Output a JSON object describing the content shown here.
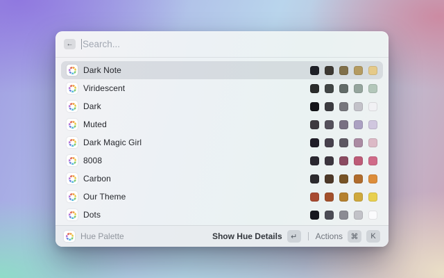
{
  "search": {
    "placeholder": "Search...",
    "back_icon": "←"
  },
  "list": [
    {
      "label": "Dark Note",
      "selected": true,
      "swatches": [
        "#1e2027",
        "#3d3933",
        "#80704a",
        "#b49b61",
        "#e5ca89"
      ]
    },
    {
      "label": "Viridescent",
      "selected": false,
      "swatches": [
        "#2a2c2b",
        "#414645",
        "#626b68",
        "#95a59d",
        "#b3c7ba"
      ]
    },
    {
      "label": "Dark",
      "selected": false,
      "swatches": [
        "#121318",
        "#3b3b40",
        "#76767c",
        "#c3c2c9",
        "#f1f1f4"
      ]
    },
    {
      "label": "Muted",
      "selected": false,
      "swatches": [
        "#3e3a40",
        "#55515c",
        "#787082",
        "#aba1c2",
        "#d0c7df"
      ]
    },
    {
      "label": "Dark Magic Girl",
      "selected": false,
      "swatches": [
        "#1f1d28",
        "#46404c",
        "#5d5862",
        "#aa8aa2",
        "#dcb9c6"
      ]
    },
    {
      "label": "8008",
      "selected": false,
      "swatches": [
        "#2a2830",
        "#3c353e",
        "#8a4a60",
        "#bd5b77",
        "#d06a88"
      ]
    },
    {
      "label": "Carbon",
      "selected": false,
      "swatches": [
        "#2c2b2e",
        "#4c3828",
        "#775426",
        "#b06c2d",
        "#dd8d3a"
      ]
    },
    {
      "label": "Our Theme",
      "selected": false,
      "swatches": [
        "#a84b31",
        "#a2502b",
        "#b5812f",
        "#cfa93d",
        "#e8d04f"
      ]
    },
    {
      "label": "Dots",
      "selected": false,
      "swatches": [
        "#16161e",
        "#4c4c55",
        "#8b8b93",
        "#c2c2c8",
        "#fbfbfd"
      ]
    }
  ],
  "footer": {
    "extension_name": "Hue Palette",
    "primary_action": "Show Hue Details",
    "primary_key": "↵",
    "actions_label": "Actions",
    "actions_keys": [
      "⌘",
      "K"
    ]
  },
  "icons": {
    "row_icon": "hue-palette-ring-icon",
    "back_icon": "back-arrow-icon"
  },
  "colors": {
    "selected_row_highlight": "#c7cbd3",
    "keycap_bg": "#d3d6db",
    "footer_text_muted": "#90959d",
    "primary_text": "#25272c"
  }
}
